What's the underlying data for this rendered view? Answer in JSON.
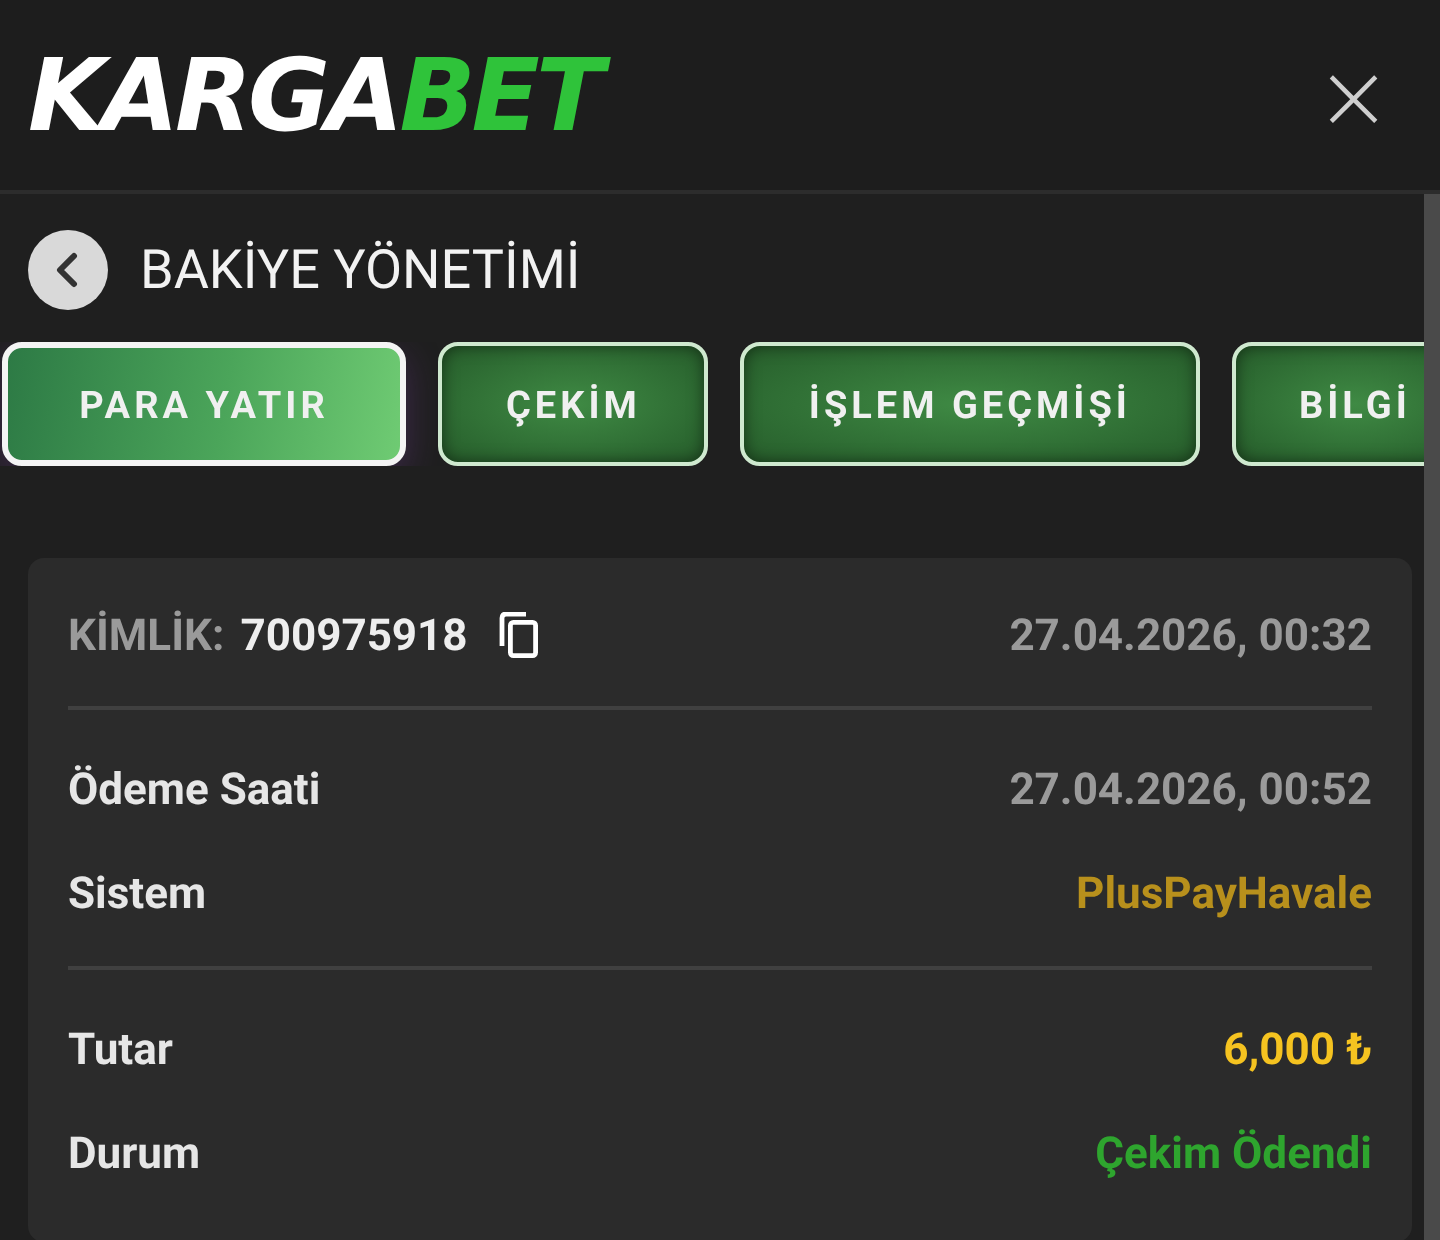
{
  "header": {
    "logo": {
      "part_1": "KARGA",
      "part_2": "BET"
    },
    "close": "×"
  },
  "page_title": "BAKİYE YÖNETİMİ",
  "tabs": [
    {
      "label": "PARA YATIR",
      "selected": true
    },
    {
      "label": "ÇEKİM",
      "selected": false
    },
    {
      "label": "İŞLEM GEÇMİŞİ",
      "selected": false
    },
    {
      "label": "BİLGİ",
      "selected": false
    }
  ],
  "transaction": {
    "id_label": "KİMLİK:",
    "id_value": "700975918",
    "created": "27.04.2026, 00:32",
    "sections": [
      [
        {
          "label": "Ödeme Saati",
          "value": "27.04.2026, 00:52",
          "kind": "date"
        },
        {
          "label": "Sistem",
          "value": "PlusPayHavale",
          "kind": "system"
        }
      ],
      [
        {
          "label": "Tutar",
          "value": "6,000 ₺",
          "kind": "amount"
        },
        {
          "label": "Durum",
          "value": "Çekim Ödendi",
          "kind": "status"
        }
      ]
    ]
  }
}
